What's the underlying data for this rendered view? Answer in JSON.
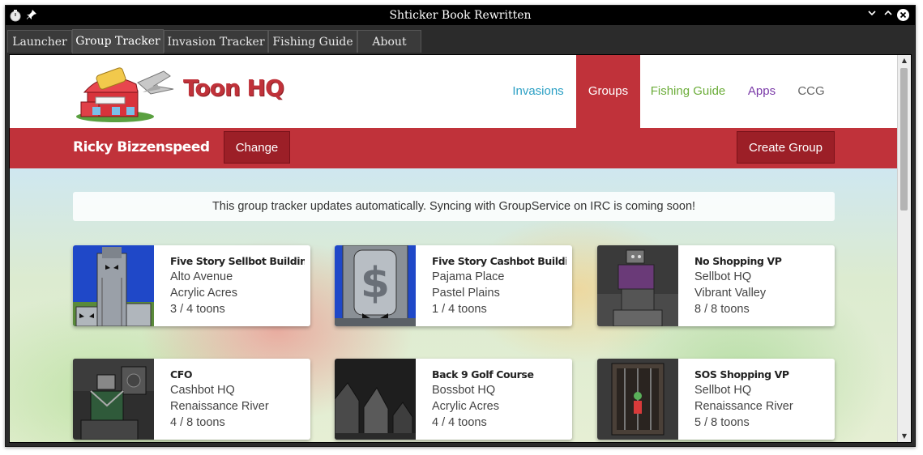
{
  "window": {
    "title": "Shticker Book Rewritten",
    "controls": [
      "chevron-down",
      "chevron-up",
      "close"
    ]
  },
  "tabs": [
    {
      "label": "Launcher"
    },
    {
      "label": "Group Tracker"
    },
    {
      "label": "Invasion Tracker"
    },
    {
      "label": "Fishing Guide"
    },
    {
      "label": "About"
    }
  ],
  "active_tab": "Group Tracker",
  "site": {
    "brand": "Toon HQ",
    "nav": [
      {
        "label": "Invasions",
        "color": "#2a9fc4"
      },
      {
        "label": "Groups",
        "color": "#ffffff"
      },
      {
        "label": "Fishing Guide",
        "color": "#6cad3a"
      },
      {
        "label": "Apps",
        "color": "#7a3aa8"
      },
      {
        "label": "CCG",
        "color": "#666666"
      }
    ],
    "active_nav": "Groups"
  },
  "user": {
    "name": "Ricky Bizzenspeed",
    "change_label": "Change",
    "create_group_label": "Create Group"
  },
  "alert": "This group tracker updates automatically. Syncing with GroupService on IRC is coming soon!",
  "groups": [
    {
      "title": "Five Story Sellbot Building",
      "street": "Alto Avenue",
      "district": "Acrylic Acres",
      "toons": "3 / 4 toons",
      "image": "sellbot-building"
    },
    {
      "title": "Five Story Cashbot Building",
      "street": "Pajama Place",
      "district": "Pastel Plains",
      "toons": "1 / 4 toons",
      "image": "cashbot-building"
    },
    {
      "title": "No Shopping VP",
      "street": "Sellbot HQ",
      "district": "Vibrant Valley",
      "toons": "8 / 8 toons",
      "image": "vp-boss"
    },
    {
      "title": "CFO",
      "street": "Cashbot HQ",
      "district": "Renaissance River",
      "toons": "4 / 8 toons",
      "image": "cfo-boss"
    },
    {
      "title": "Back 9 Golf Course",
      "street": "Bossbot HQ",
      "district": "Acrylic Acres",
      "toons": "4 / 4 toons",
      "image": "golf-course"
    },
    {
      "title": "SOS Shopping VP",
      "street": "Sellbot HQ",
      "district": "Renaissance River",
      "toons": "5 / 8 toons",
      "image": "sos-vp"
    }
  ],
  "colors": {
    "accent": "#c0323a",
    "accent_dark": "#9c1f27",
    "titlebar": "#000000"
  }
}
